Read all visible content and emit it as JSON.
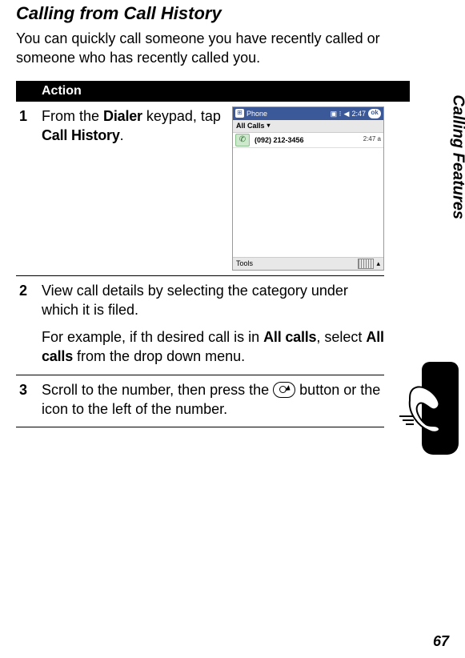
{
  "heading": "Calling from Call History",
  "intro": "You can quickly call someone you have recently called or someone who has recently called you.",
  "action_header": "Action",
  "steps": [
    {
      "num": "1",
      "parts": [
        "From the ",
        {
          "style": "cond",
          "text": "Dialer"
        },
        " keypad, tap ",
        {
          "style": "cond",
          "text": "Call History"
        },
        "."
      ],
      "screenshot": {
        "title_app": "Phone",
        "time": "2:47",
        "ok": "ok",
        "subbar": "All Calls",
        "row": {
          "number": "(092) 212-3456",
          "time": "2:47 a"
        },
        "tools": "Tools"
      }
    },
    {
      "num": "2",
      "paragraphs": [
        [
          "View call details by selecting the category under which it is filed."
        ],
        [
          "For example, if th desired call is in ",
          {
            "style": "cond",
            "text": "All calls"
          },
          ", select ",
          {
            "style": "cond",
            "text": "All calls"
          },
          " from the drop down menu."
        ]
      ]
    },
    {
      "num": "3",
      "paragraphs": [
        [
          "Scroll to the number, then press the ",
          {
            "icon": "action-button"
          },
          " button or the icon to the left of the number."
        ]
      ]
    }
  ],
  "side_label": "Calling Features",
  "page_number": "67"
}
